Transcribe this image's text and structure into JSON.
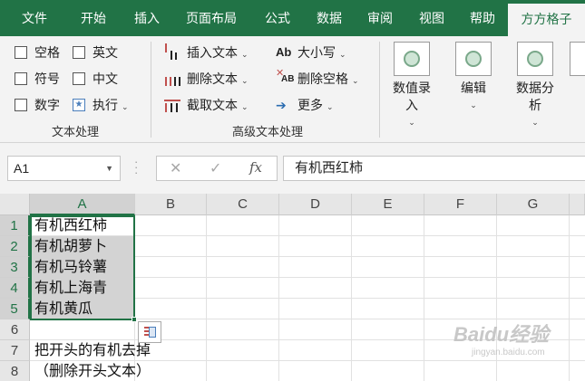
{
  "tabs": [
    "文件",
    "开始",
    "插入",
    "页面布局",
    "公式",
    "数据",
    "审阅",
    "视图",
    "帮助",
    "方方格子"
  ],
  "active_tab": "方方格子",
  "ribbon": {
    "text_group": {
      "label": "文本处理",
      "items": [
        "空格",
        "英文",
        "符号",
        "中文",
        "数字",
        "执行"
      ]
    },
    "advanced_group": {
      "label": "高级文本处理",
      "insert_text": "插入文本",
      "delete_text": "删除文本",
      "extract_text": "截取文本",
      "case": "大小写",
      "delete_spaces": "删除空格",
      "more": "更多",
      "case_icon": "Ab",
      "delete_spaces_icon": "AB"
    },
    "big_buttons": [
      "数值录入",
      "编辑",
      "数据分析"
    ]
  },
  "formula_bar": {
    "name_box": "A1",
    "fx": "fx",
    "content": "有机西红柿"
  },
  "columns": [
    "A",
    "B",
    "C",
    "D",
    "E",
    "F",
    "G"
  ],
  "rows": [
    "1",
    "2",
    "3",
    "4",
    "5",
    "6",
    "7",
    "8"
  ],
  "cells": {
    "A1": "有机西红柿",
    "A2": "有机胡萝卜",
    "A3": "有机马铃薯",
    "A4": "有机上海青",
    "A5": "有机黄瓜",
    "A7": "把开头的有机去掉",
    "A8": "（删除开头文本）"
  },
  "watermark": {
    "brand": "Baidu经验",
    "url": "jingyan.baidu.com"
  },
  "colors": {
    "ribbon_green": "#217346",
    "selection_gray": "#d3d3d3"
  }
}
